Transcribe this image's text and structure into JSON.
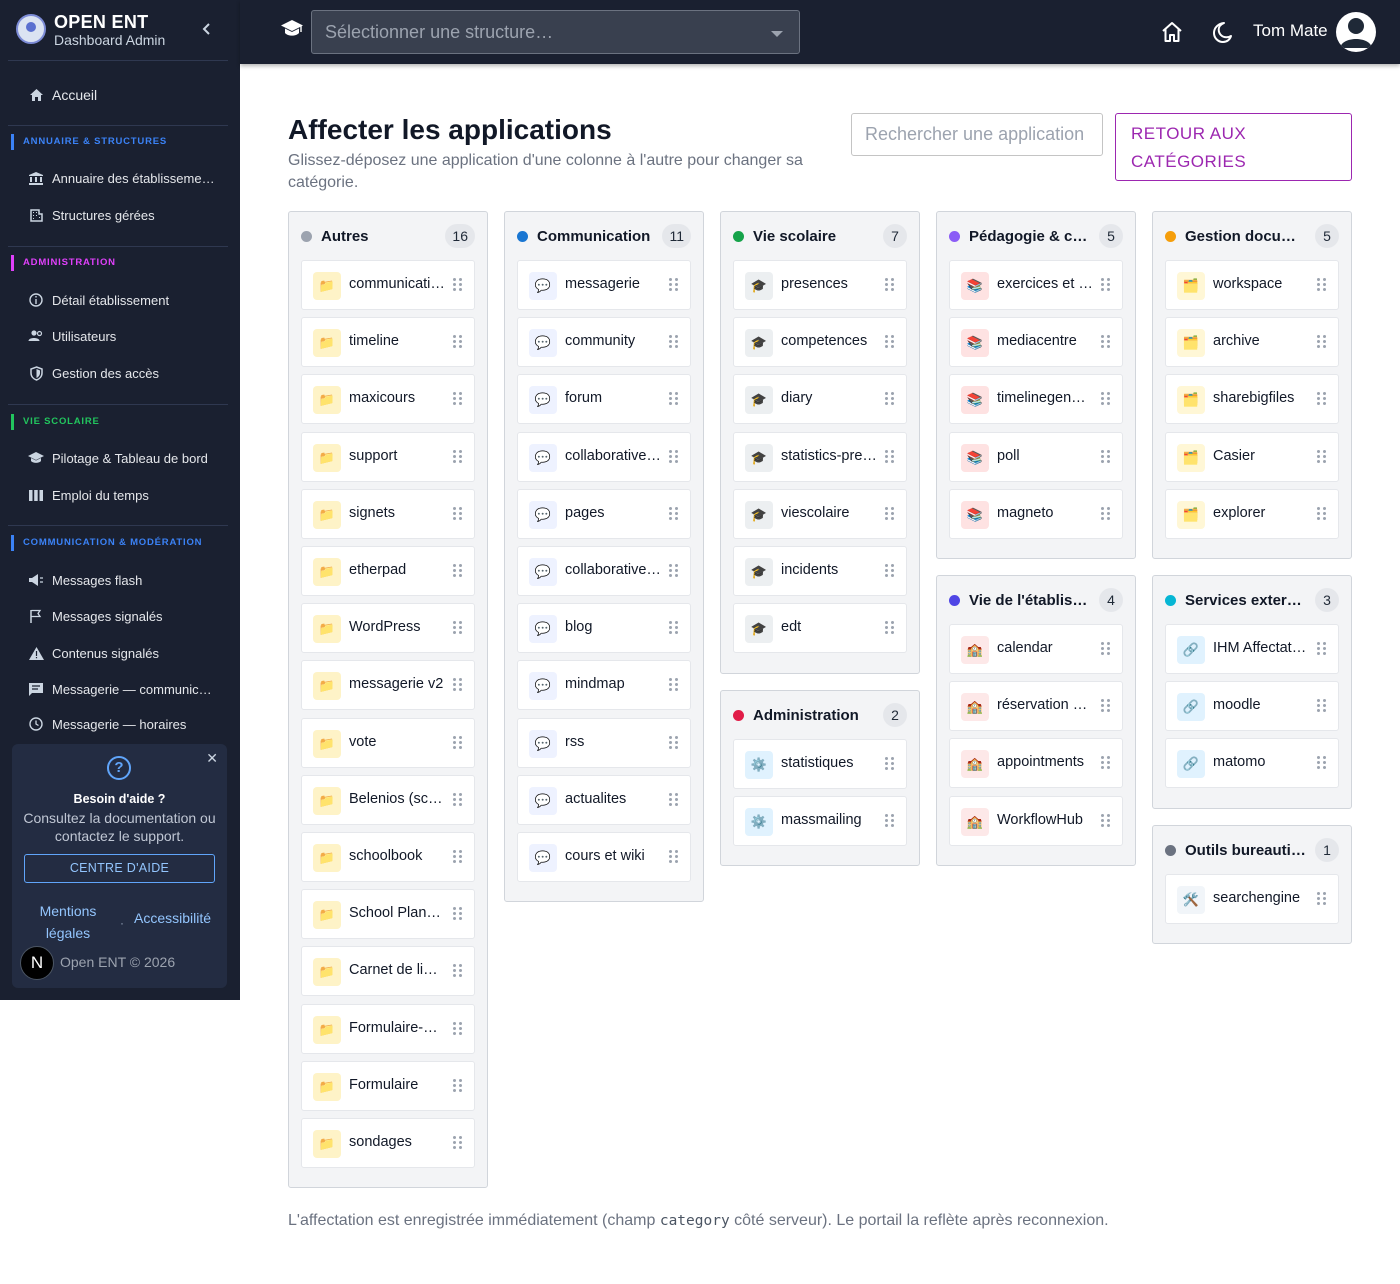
{
  "brand": {
    "title": "OPEN ENT",
    "subtitle": "Dashboard Admin"
  },
  "sidebar": {
    "home": "Accueil",
    "sections": [
      {
        "title": "ANNUAIRE & STRUCTURES",
        "color": "#3b82f6",
        "items": [
          "Annuaire des établissements",
          "Structures gérées"
        ]
      },
      {
        "title": "ADMINISTRATION",
        "color": "#e040fb",
        "items": [
          "Détail établissement",
          "Utilisateurs",
          "Gestion des accès"
        ]
      },
      {
        "title": "VIE SCOLAIRE",
        "color": "#22c55e",
        "items": [
          "Pilotage & Tableau de bord",
          "Emploi du temps"
        ]
      },
      {
        "title": "COMMUNICATION & MODÉRATION",
        "color": "#3b82f6",
        "items": [
          "Messages flash",
          "Messages signalés",
          "Contenus signalés",
          "Messagerie — communication",
          "Messagerie — horaires"
        ]
      }
    ],
    "help": {
      "title": "Besoin d'aide ?",
      "text": "Consultez la documentation ou contactez le support.",
      "button": "CENTRE D'AIDE",
      "link1": "Mentions légales",
      "separator": "·",
      "link2": "Accessibilité",
      "badge": "N",
      "copyright": "Open ENT © 2026"
    }
  },
  "topbar": {
    "select_placeholder": "Sélectionner une structure…",
    "user_name": "Tom Mate"
  },
  "main": {
    "title": "Affecter les applications",
    "subtitle": "Glissez-déposez une application d'une colonne à l'autre pour changer sa catégorie.",
    "search_placeholder": "Rechercher une application",
    "back_button": "RETOUR AUX CATÉGORIES",
    "footnote_before": "L'affectation est enregistrée immédiatement (champ ",
    "footnote_code": "category",
    "footnote_after": " côté serveur). Le portail la reflète après reconnexion."
  },
  "columns": [
    {
      "name": "Autres",
      "count": "16",
      "color": "#9ca3af",
      "icon": "folder-icon",
      "apps": [
        "communication",
        "timeline",
        "maxicours",
        "support",
        "signets",
        "etherpad",
        "WordPress",
        "messagerie v2",
        "vote",
        "Belenios (scrutin)",
        "schoolbook",
        "School Planner",
        "Carnet de liaison",
        "Formulaire-Réponse",
        "Formulaire",
        "sondages"
      ]
    },
    {
      "name": "Communication",
      "count": "11",
      "color": "#1976d2",
      "icon": "chat-bubble-icon",
      "apps": [
        "messagerie",
        "community",
        "forum",
        "collaborativewall",
        "pages",
        "collaborativeeditor",
        "blog",
        "mindmap",
        "rss",
        "actualites",
        "cours et wiki"
      ]
    },
    {
      "name": "Vie scolaire",
      "count": "7",
      "color": "#16a34a",
      "icon": "graduation-cap-icon",
      "apps": [
        "presences",
        "competences",
        "diary",
        "statistics-presences",
        "viescolaire",
        "incidents",
        "edt"
      ]
    },
    {
      "name": "Administration",
      "count": "2",
      "color": "#e11d48",
      "icon": "gear-icon",
      "apps": [
        "statistiques",
        "massmailing"
      ]
    },
    {
      "name": "Pédagogie & contenus",
      "count": "5",
      "color": "#8b5cf6",
      "icon": "books-icon",
      "apps": [
        "exercices et évaluations",
        "mediacentre",
        "timelinegenerator",
        "poll",
        "magneto"
      ]
    },
    {
      "name": "Vie de l'établissement",
      "count": "4",
      "color": "#4f46e5",
      "icon": "school-icon",
      "apps": [
        "calendar",
        "réservation de ressources",
        "appointments",
        "WorkflowHub"
      ]
    },
    {
      "name": "Gestion documentaire",
      "count": "5",
      "color": "#f59e0b",
      "icon": "folder-open-icon",
      "apps": [
        "workspace",
        "archive",
        "sharebigfiles",
        "Casier",
        "explorer"
      ]
    },
    {
      "name": "Services externes",
      "count": "3",
      "color": "#06b6d4",
      "icon": "link-icon",
      "apps": [
        "IHM Affectation",
        "moodle",
        "matomo"
      ]
    },
    {
      "name": "Outils bureautiques",
      "count": "1",
      "color": "#6b7280",
      "icon": "tools-icon",
      "apps": [
        "searchengine"
      ]
    }
  ]
}
